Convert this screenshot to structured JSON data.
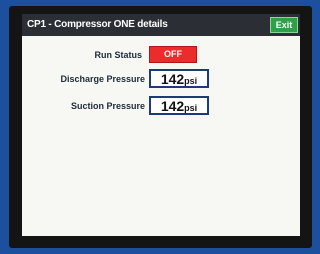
{
  "header": {
    "title": "CP1 - Compressor ONE details",
    "exit_label": "Exit"
  },
  "fields": {
    "run_status": {
      "label": "Run Status",
      "value": "OFF",
      "color": "#ec2b2b"
    },
    "discharge_pressure": {
      "label": "Discharge Pressure",
      "value": "142",
      "unit": "psi"
    },
    "suction_pressure": {
      "label": "Suction Pressure",
      "value": "142",
      "unit": "psi"
    }
  }
}
